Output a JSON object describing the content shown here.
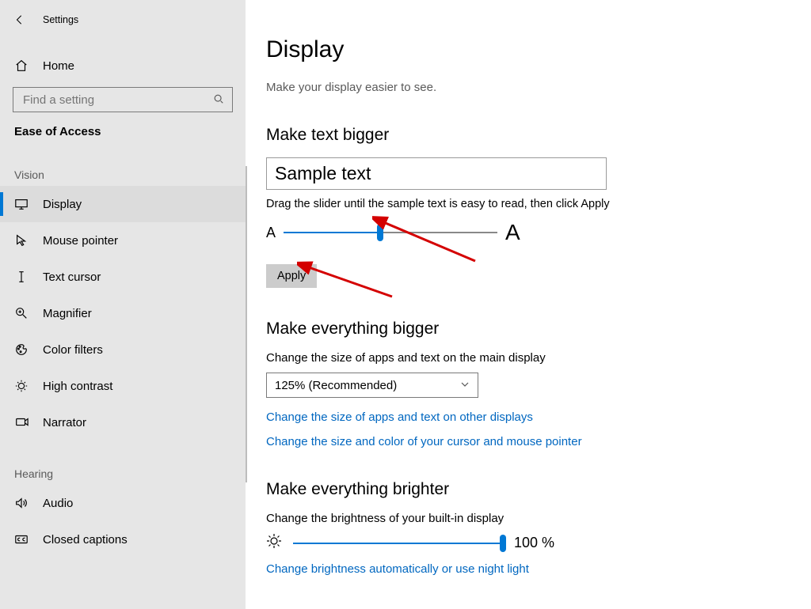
{
  "window": {
    "title": "Settings"
  },
  "sidebar": {
    "home": "Home",
    "search_placeholder": "Find a setting",
    "category": "Ease of Access",
    "groups": {
      "vision": {
        "label": "Vision",
        "items": [
          {
            "key": "display",
            "label": "Display",
            "selected": true
          },
          {
            "key": "mouse-pointer",
            "label": "Mouse pointer",
            "selected": false
          },
          {
            "key": "text-cursor",
            "label": "Text cursor",
            "selected": false
          },
          {
            "key": "magnifier",
            "label": "Magnifier",
            "selected": false
          },
          {
            "key": "color-filters",
            "label": "Color filters",
            "selected": false
          },
          {
            "key": "high-contrast",
            "label": "High contrast",
            "selected": false
          },
          {
            "key": "narrator",
            "label": "Narrator",
            "selected": false
          }
        ]
      },
      "hearing": {
        "label": "Hearing",
        "items": [
          {
            "key": "audio",
            "label": "Audio",
            "selected": false
          },
          {
            "key": "closed-captions",
            "label": "Closed captions",
            "selected": false
          }
        ]
      }
    }
  },
  "main": {
    "title": "Display",
    "subtitle": "Make your display easier to see.",
    "text_bigger": {
      "heading": "Make text bigger",
      "sample": "Sample text",
      "hint": "Drag the slider until the sample text is easy to read, then click Apply",
      "small_a": "A",
      "big_a": "A",
      "slider_percent": 45,
      "apply": "Apply"
    },
    "everything_bigger": {
      "heading": "Make everything bigger",
      "desc": "Change the size of apps and text on the main display",
      "selected": "125% (Recommended)",
      "link_other_displays": "Change the size of apps and text on other displays",
      "link_cursor": "Change the size and color of your cursor and mouse pointer"
    },
    "brighter": {
      "heading": "Make everything brighter",
      "desc": "Change the brightness of your built-in display",
      "slider_percent": 100,
      "value_label": "100 %",
      "link_nightlight": "Change brightness automatically or use night light"
    }
  }
}
